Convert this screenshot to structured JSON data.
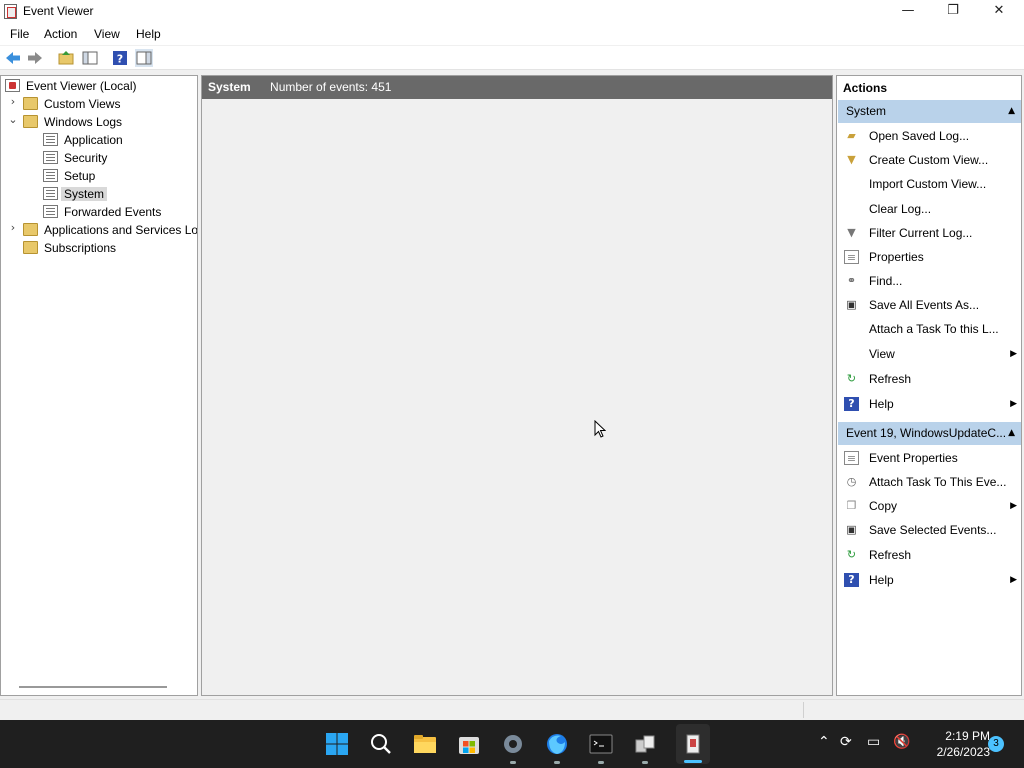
{
  "window": {
    "title": "Event Viewer",
    "controls": {
      "minimize": "—",
      "maximize": "❐",
      "close": "✕"
    }
  },
  "menubar": {
    "items": [
      "File",
      "Action",
      "View",
      "Help"
    ]
  },
  "toolbar": {
    "icons": [
      "back-arrow-icon",
      "forward-arrow-icon",
      "up-folder-icon",
      "show-hide-tree-icon",
      "help-icon",
      "show-hide-action-pane-icon"
    ]
  },
  "tree": {
    "root": "Event Viewer (Local)",
    "custom_views": "Custom Views",
    "windows_logs": "Windows Logs",
    "logs": [
      "Application",
      "Security",
      "Setup",
      "System",
      "Forwarded Events"
    ],
    "apps_services": "Applications and Services Lo",
    "subscriptions": "Subscriptions",
    "selected": "System"
  },
  "center": {
    "log_name": "System",
    "event_count": "Number of events: 451"
  },
  "actions": {
    "title": "Actions",
    "section1": {
      "header": "System",
      "items": [
        "Open Saved Log...",
        "Create Custom View...",
        "Import Custom View...",
        "Clear Log...",
        "Filter Current Log...",
        "Properties",
        "Find...",
        "Save All Events As...",
        "Attach a Task To this L...",
        "View",
        "Refresh",
        "Help"
      ]
    },
    "section2": {
      "header": "Event 19, WindowsUpdateC...",
      "items": [
        "Event Properties",
        "Attach Task To This Eve...",
        "Copy",
        "Save Selected Events...",
        "Refresh",
        "Help"
      ]
    }
  },
  "taskbar": {
    "apps": [
      "start-icon",
      "search-icon",
      "file-explorer-icon",
      "store-icon",
      "settings-icon",
      "firefox-icon",
      "terminal-icon",
      "network-app-icon",
      "event-viewer-icon"
    ],
    "time": "2:19 PM",
    "date": "2/26/2023",
    "notification_count": "3"
  },
  "colors": {
    "section_header": "#b9d2ea",
    "center_header": "#696969",
    "selected": "#d9d9d9",
    "taskbar": "#1f1f1f"
  }
}
